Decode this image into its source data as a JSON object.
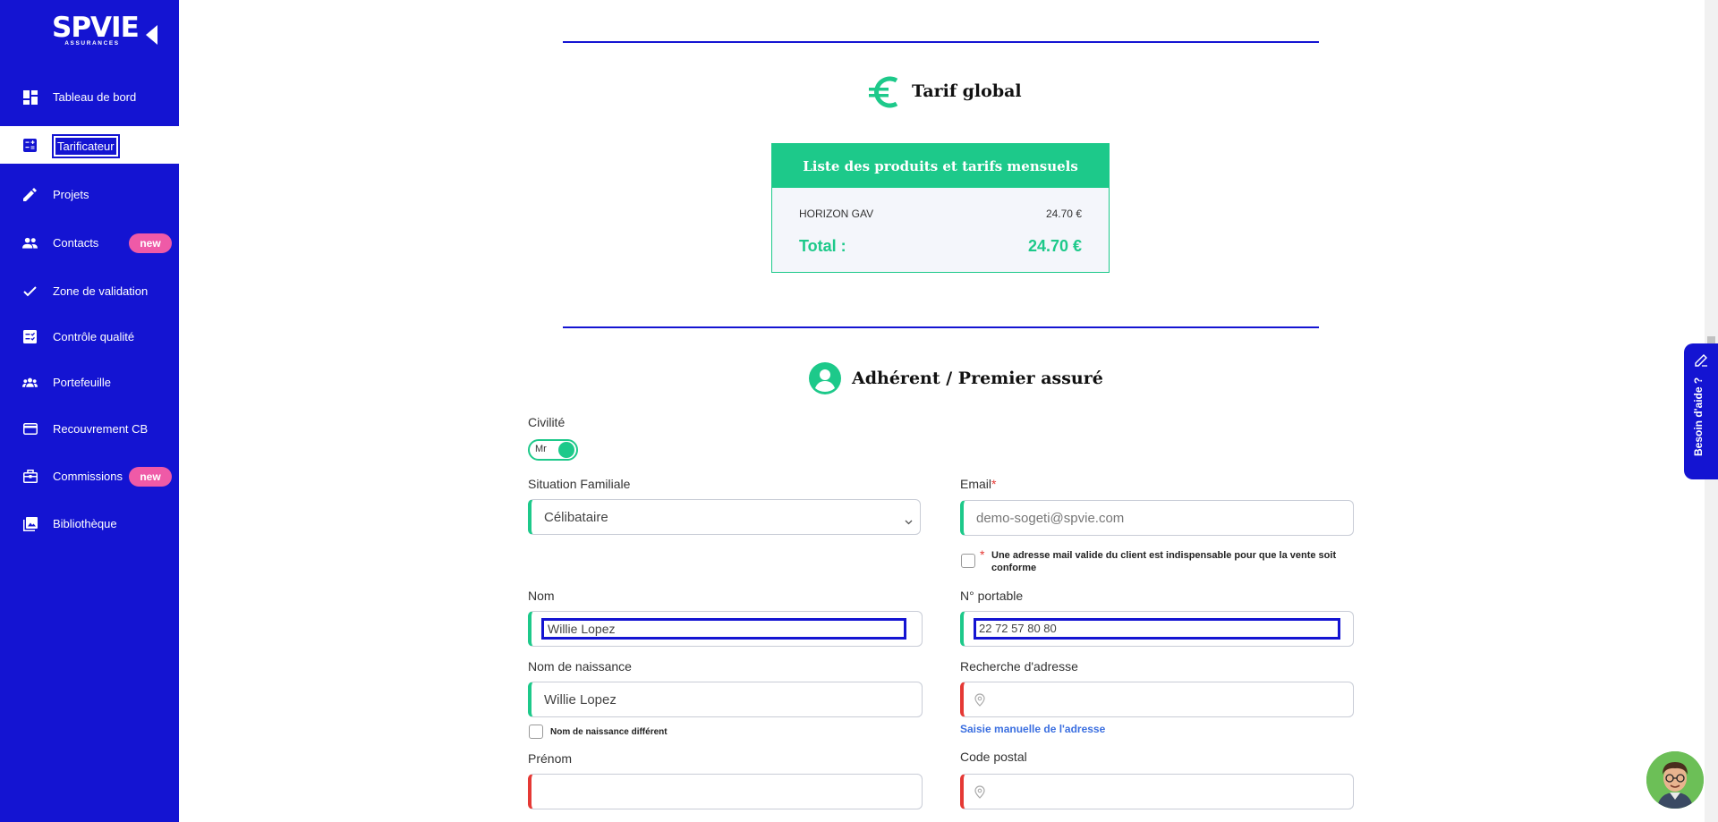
{
  "brand": {
    "logo_main": "SPVIE",
    "logo_sub": "ASSURANCES"
  },
  "sidebar": {
    "items": [
      {
        "label": "Tableau de bord",
        "icon": "dashboard-icon"
      },
      {
        "label": "Tarificateur",
        "icon": "calculator-icon",
        "active": true
      },
      {
        "label": "Projets",
        "icon": "pencil-icon"
      },
      {
        "label": "Contacts",
        "icon": "people-icon",
        "badge": "new"
      },
      {
        "label": "Zone de validation",
        "icon": "check-icon"
      },
      {
        "label": "Contrôle qualité",
        "icon": "checklist-icon"
      },
      {
        "label": "Portefeuille",
        "icon": "group-icon"
      },
      {
        "label": "Recouvrement CB",
        "icon": "credit-card-icon"
      },
      {
        "label": "Commissions",
        "icon": "briefcase-icon",
        "badge": "new"
      },
      {
        "label": "Bibliothèque",
        "icon": "photo-library-icon"
      }
    ]
  },
  "tarif": {
    "title": "Tarif global",
    "box_title": "Liste des produits et tarifs mensuels",
    "product_name": "HORIZON GAV",
    "product_price": "24.70 €",
    "total_label": "Total :",
    "total_value": "24.70 €"
  },
  "adherent": {
    "title": "Adhérent / Premier assuré",
    "civilite_label": "Civilité",
    "civilite_value": "Mr",
    "situation_label": "Situation Familiale",
    "situation_value": "Célibataire",
    "email_label": "Email",
    "email_required": "*",
    "email_value": "demo-sogeti@spvie.com",
    "email_notice": "Une adresse mail valide du client est indispensable pour que la vente soit conforme",
    "nom_label": "Nom",
    "nom_value": "Willie Lopez",
    "portable_label": "N° portable",
    "portable_value": "22 72 57 80 80",
    "naissance_label": "Nom de naissance",
    "naissance_value": "Willie Lopez",
    "naissance_diff_label": "Nom de naissance différent",
    "adresse_label": "Recherche d'adresse",
    "adresse_manual_link": "Saisie manuelle de l'adresse",
    "prenom_label": "Prénom",
    "code_postal_label": "Code postal"
  },
  "help": {
    "label": "Besoin d'aide ?"
  },
  "colors": {
    "primary": "#1414d2",
    "accent": "#1dc98a",
    "badge": "#ef5aa7",
    "error": "#e53935"
  }
}
